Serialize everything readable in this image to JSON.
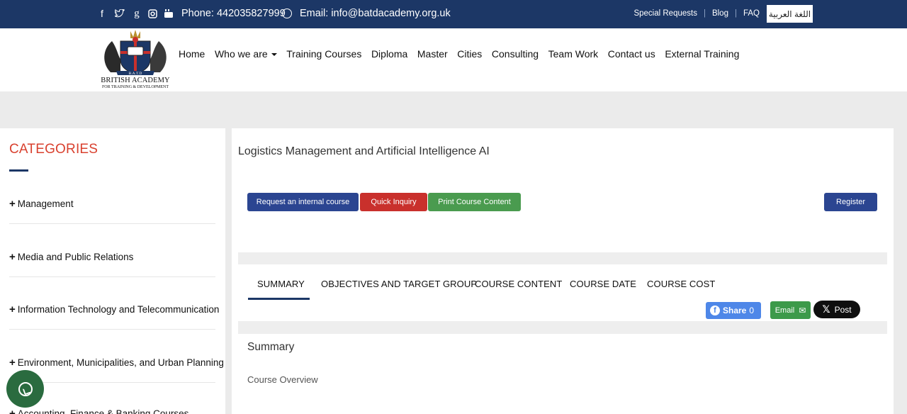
{
  "topbar": {
    "phone": "Phone: 442035827999",
    "email": "Email: info@batdacademy.org.uk",
    "links": [
      "Special Requests",
      "Blog",
      "FAQ"
    ],
    "arabic_label": "اللغة العربية"
  },
  "logo": {
    "line1": "BRITISH ACADEMY",
    "line2": "FOR TRAINING & DEVELOPMENT",
    "emblem_text": "B.A.T.D"
  },
  "nav": {
    "home": "Home",
    "who": "Who we are",
    "training": "Training Courses",
    "diploma": "Diploma",
    "master": "Master",
    "cities": "Cities",
    "consulting": "Consulting",
    "teamwork": "Team Work",
    "contact": "Contact us",
    "external": "External Training"
  },
  "sidebar": {
    "title": "CATEGORIES",
    "items": [
      "Management",
      "Media and Public Relations",
      "Information Technology and Telecommunication",
      "Environment, Municipalities, and Urban Planning",
      "Accounting, Finance & Banking Courses"
    ]
  },
  "main": {
    "course_title": "Logistics Management and Artificial Intelligence AI",
    "buttons": {
      "internal": "Request an internal course",
      "inquiry": "Quick Inquiry",
      "print": "Print Course Content",
      "register": "Register"
    },
    "tabs": [
      "SUMMARY",
      "OBJECTIVES AND TARGET GROUP",
      "COURSE CONTENT",
      "COURSE DATE",
      "COURSE COST"
    ],
    "share": {
      "fb_label": "Share",
      "fb_count": "0",
      "email_label": "Email",
      "x_label": "Post"
    },
    "summary_heading": "Summary",
    "overview_label": "Course Overview"
  },
  "colors": {
    "navy": "#1c3766",
    "red": "#c9302c",
    "green": "#4a9b4f",
    "category_title": "#d9412f"
  }
}
